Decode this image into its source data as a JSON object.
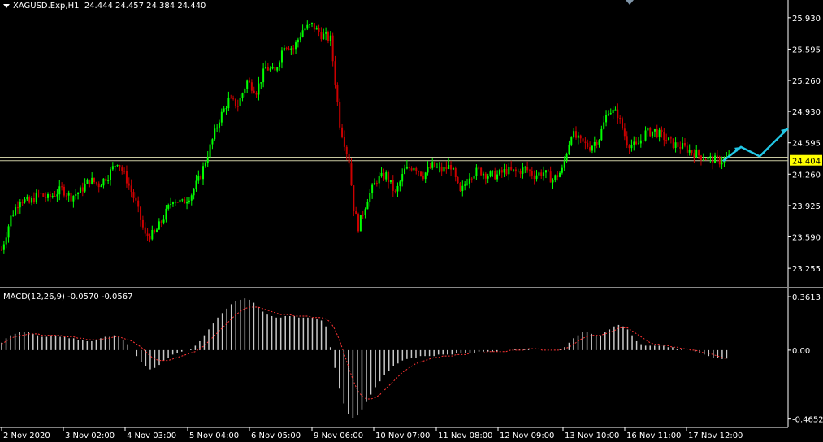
{
  "header": {
    "symbol_line": "XAGUSD.Exp,H1  24.444 24.457 24.384 24.440",
    "macd_line": "MACD(12,26,9) -0.0570 -0.0567"
  },
  "colors": {
    "background": "#000000",
    "bull": "#00ff00",
    "bear": "#cc0000",
    "grid_text": "#ffffff",
    "hline": "#c8c8a0",
    "price_tag_bg": "#ffff00",
    "signal": "#ff3333",
    "histogram": "#c8c8c8",
    "arrow": "#22c8e6"
  },
  "chart_data": [
    {
      "type": "candlestick",
      "title": "XAGUSD.Exp,H1",
      "y_ticks": [
        "25.930",
        "25.595",
        "25.260",
        "24.930",
        "24.595",
        "24.260",
        "23.925",
        "23.590",
        "23.255"
      ],
      "ylim": [
        23.1,
        26.05
      ],
      "x_tick_labels": [
        "2 Nov 2020",
        "3 Nov 02:00",
        "4 Nov 03:00",
        "5 Nov 04:00",
        "6 Nov 05:00",
        "9 Nov 06:00",
        "10 Nov 07:00",
        "11 Nov 08:00",
        "12 Nov 09:00",
        "13 Nov 10:00",
        "16 Nov 11:00",
        "17 Nov 12:00"
      ],
      "current_price_label": "24.404",
      "hidden_price_label": "24.440",
      "horizontal_lines": [
        24.44,
        24.404
      ],
      "close_path": [
        [
          0,
          23.45
        ],
        [
          4,
          23.8
        ],
        [
          8,
          24.0
        ],
        [
          12,
          23.95
        ],
        [
          16,
          24.05
        ],
        [
          20,
          24.0
        ],
        [
          26,
          24.1
        ],
        [
          30,
          24.02
        ],
        [
          34,
          24.08
        ],
        [
          38,
          24.2
        ],
        [
          42,
          24.15
        ],
        [
          46,
          24.25
        ],
        [
          50,
          24.4
        ],
        [
          54,
          24.2
        ],
        [
          58,
          23.95
        ],
        [
          62,
          23.6
        ],
        [
          66,
          23.62
        ],
        [
          70,
          23.8
        ],
        [
          74,
          24.0
        ],
        [
          78,
          23.95
        ],
        [
          82,
          24.05
        ],
        [
          86,
          24.25
        ],
        [
          90,
          24.55
        ],
        [
          94,
          24.85
        ],
        [
          98,
          25.05
        ],
        [
          102,
          25.0
        ],
        [
          106,
          25.25
        ],
        [
          110,
          25.15
        ],
        [
          114,
          25.4
        ],
        [
          118,
          25.35
        ],
        [
          122,
          25.65
        ],
        [
          126,
          25.6
        ],
        [
          130,
          25.8
        ],
        [
          134,
          25.85
        ],
        [
          138,
          25.75
        ],
        [
          142,
          25.7
        ],
        [
          146,
          24.8
        ],
        [
          150,
          24.4
        ],
        [
          152,
          23.9
        ],
        [
          154,
          23.7
        ],
        [
          158,
          24.0
        ],
        [
          162,
          24.2
        ],
        [
          166,
          24.25
        ],
        [
          170,
          24.05
        ],
        [
          174,
          24.3
        ],
        [
          178,
          24.35
        ],
        [
          182,
          24.25
        ],
        [
          186,
          24.35
        ],
        [
          190,
          24.3
        ],
        [
          194,
          24.35
        ],
        [
          198,
          24.05
        ],
        [
          202,
          24.25
        ],
        [
          206,
          24.3
        ],
        [
          210,
          24.25
        ],
        [
          214,
          24.25
        ],
        [
          218,
          24.3
        ],
        [
          222,
          24.28
        ],
        [
          226,
          24.32
        ],
        [
          230,
          24.25
        ],
        [
          234,
          24.28
        ],
        [
          238,
          24.2
        ],
        [
          242,
          24.3
        ],
        [
          246,
          24.7
        ],
        [
          250,
          24.6
        ],
        [
          254,
          24.55
        ],
        [
          258,
          24.65
        ],
        [
          262,
          24.95
        ],
        [
          266,
          24.9
        ],
        [
          270,
          24.6
        ],
        [
          274,
          24.55
        ],
        [
          278,
          24.7
        ],
        [
          282,
          24.72
        ],
        [
          286,
          24.65
        ],
        [
          290,
          24.58
        ],
        [
          294,
          24.55
        ],
        [
          298,
          24.5
        ],
        [
          302,
          24.45
        ],
        [
          306,
          24.42
        ],
        [
          310,
          24.4
        ],
        [
          314,
          24.44
        ]
      ],
      "forecast_arrow": [
        [
          24.4
        ],
        [
          24.55
        ],
        [
          24.45
        ],
        [
          24.75
        ]
      ]
    },
    {
      "type": "histogram",
      "title": "MACD(12,26,9)",
      "y_ticks": [
        "0.3613",
        "0.00",
        "-0.4652"
      ],
      "ylim": [
        -0.5,
        0.4
      ],
      "main_value": -0.057,
      "signal_value": -0.0567,
      "values": [
        0.05,
        0.08,
        0.1,
        0.11,
        0.12,
        0.12,
        0.12,
        0.11,
        0.1,
        0.09,
        0.09,
        0.1,
        0.1,
        0.09,
        0.09,
        0.08,
        0.08,
        0.07,
        0.07,
        0.06,
        0.06,
        0.07,
        0.08,
        0.09,
        0.09,
        0.1,
        0.09,
        0.07,
        0.04,
        0.0,
        -0.04,
        -0.08,
        -0.11,
        -0.13,
        -0.12,
        -0.1,
        -0.07,
        -0.05,
        -0.03,
        -0.02,
        -0.01,
        0.0,
        0.01,
        0.03,
        0.06,
        0.1,
        0.14,
        0.18,
        0.22,
        0.25,
        0.28,
        0.31,
        0.33,
        0.34,
        0.35,
        0.34,
        0.32,
        0.29,
        0.26,
        0.24,
        0.23,
        0.22,
        0.22,
        0.23,
        0.23,
        0.23,
        0.22,
        0.22,
        0.22,
        0.22,
        0.21,
        0.2,
        0.16,
        0.02,
        -0.12,
        -0.26,
        -0.36,
        -0.43,
        -0.46,
        -0.44,
        -0.4,
        -0.35,
        -0.3,
        -0.25,
        -0.21,
        -0.17,
        -0.14,
        -0.11,
        -0.09,
        -0.07,
        -0.06,
        -0.05,
        -0.05,
        -0.04,
        -0.04,
        -0.04,
        -0.04,
        -0.03,
        -0.03,
        -0.03,
        -0.03,
        -0.02,
        -0.02,
        -0.02,
        -0.02,
        -0.02,
        -0.01,
        -0.01,
        -0.01,
        -0.01,
        -0.01,
        0.0,
        0.0,
        0.0,
        0.01,
        0.01,
        0.01,
        0.01,
        0.0,
        0.0,
        0.0,
        0.0,
        0.0,
        0.0,
        0.01,
        0.02,
        0.05,
        0.08,
        0.1,
        0.12,
        0.12,
        0.11,
        0.1,
        0.1,
        0.12,
        0.14,
        0.16,
        0.17,
        0.16,
        0.14,
        0.1,
        0.06,
        0.04,
        0.03,
        0.03,
        0.03,
        0.03,
        0.03,
        0.02,
        0.02,
        0.01,
        0.01,
        0.0,
        0.0,
        -0.01,
        -0.02,
        -0.03,
        -0.04,
        -0.05,
        -0.05,
        -0.06,
        -0.057
      ],
      "signal": [
        0.04,
        0.06,
        0.08,
        0.09,
        0.1,
        0.1,
        0.11,
        0.11,
        0.11,
        0.1,
        0.1,
        0.1,
        0.1,
        0.1,
        0.09,
        0.09,
        0.09,
        0.08,
        0.08,
        0.07,
        0.07,
        0.07,
        0.07,
        0.08,
        0.08,
        0.09,
        0.09,
        0.08,
        0.07,
        0.06,
        0.04,
        0.02,
        -0.01,
        -0.04,
        -0.06,
        -0.07,
        -0.07,
        -0.07,
        -0.06,
        -0.05,
        -0.04,
        -0.03,
        -0.02,
        -0.01,
        0.01,
        0.03,
        0.06,
        0.09,
        0.12,
        0.15,
        0.18,
        0.21,
        0.24,
        0.26,
        0.28,
        0.29,
        0.29,
        0.29,
        0.28,
        0.27,
        0.26,
        0.25,
        0.24,
        0.24,
        0.24,
        0.23,
        0.23,
        0.23,
        0.23,
        0.22,
        0.22,
        0.22,
        0.21,
        0.19,
        0.14,
        0.07,
        -0.02,
        -0.11,
        -0.2,
        -0.27,
        -0.31,
        -0.33,
        -0.33,
        -0.32,
        -0.3,
        -0.27,
        -0.24,
        -0.21,
        -0.18,
        -0.15,
        -0.13,
        -0.11,
        -0.09,
        -0.08,
        -0.07,
        -0.06,
        -0.05,
        -0.05,
        -0.04,
        -0.04,
        -0.04,
        -0.03,
        -0.03,
        -0.03,
        -0.02,
        -0.02,
        -0.02,
        -0.02,
        -0.01,
        -0.01,
        -0.01,
        -0.01,
        -0.01,
        0.0,
        0.0,
        0.0,
        0.0,
        0.01,
        0.01,
        0.01,
        0.0,
        0.0,
        0.0,
        0.0,
        0.0,
        0.01,
        0.02,
        0.04,
        0.06,
        0.08,
        0.09,
        0.1,
        0.1,
        0.1,
        0.11,
        0.12,
        0.13,
        0.15,
        0.15,
        0.15,
        0.13,
        0.11,
        0.09,
        0.07,
        0.05,
        0.04,
        0.04,
        0.03,
        0.03,
        0.02,
        0.02,
        0.01,
        0.01,
        0.0,
        0.0,
        -0.01,
        -0.02,
        -0.02,
        -0.03,
        -0.04,
        -0.05,
        -0.0567
      ]
    }
  ]
}
